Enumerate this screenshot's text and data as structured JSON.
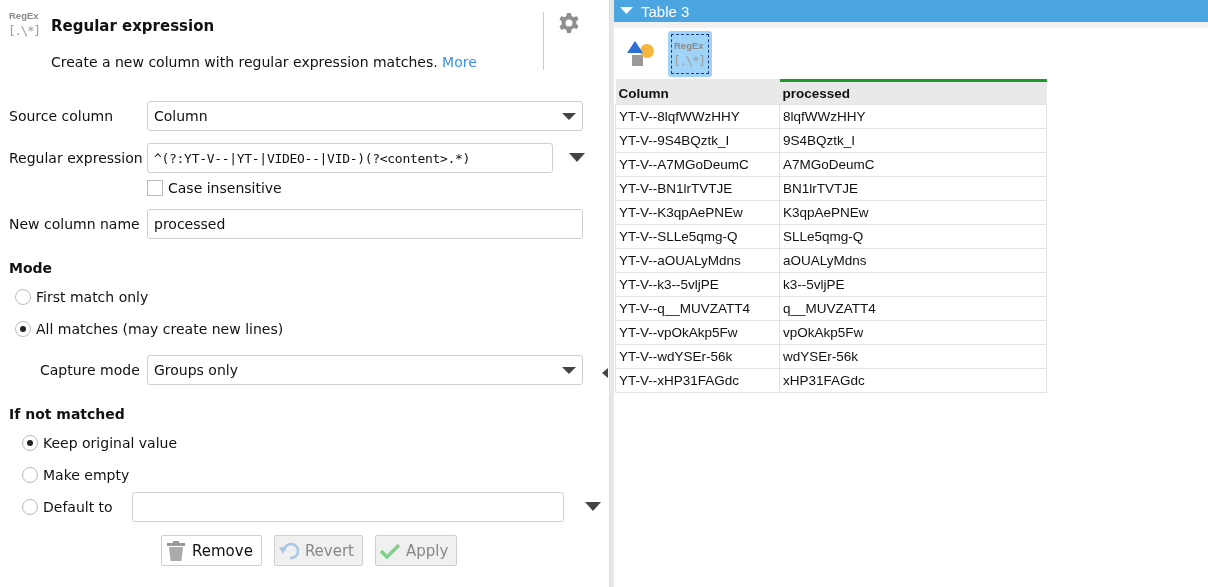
{
  "node": {
    "icon_label": "RegEx",
    "icon_symbol": "[.\\*]",
    "title": "Regular expression",
    "description": "Create a new column with regular expression matches.",
    "more_link": "More"
  },
  "source_column": {
    "label": "Source column",
    "value": "Column"
  },
  "regular_expression": {
    "label": "Regular expression",
    "value": "^(?:YT-V--|YT-|VIDEO--|VID-)(?<content>.*)"
  },
  "case_insensitive": {
    "label": "Case insensitive",
    "checked": false
  },
  "new_column_name": {
    "label": "New column name",
    "value": "processed"
  },
  "mode": {
    "title": "Mode",
    "options": [
      {
        "label": "First match only",
        "selected": false
      },
      {
        "label": "All matches (may create new lines)",
        "selected": true
      }
    ],
    "capture_mode": {
      "label": "Capture mode",
      "value": "Groups only"
    }
  },
  "if_not_matched": {
    "title": "If not matched",
    "options": [
      {
        "label": "Keep original value",
        "selected": true
      },
      {
        "label": "Make empty",
        "selected": false
      },
      {
        "label": "Default to",
        "selected": false
      }
    ]
  },
  "buttons": [
    {
      "kind": "remove",
      "label": "Remove",
      "disabled": false
    },
    {
      "kind": "revert",
      "label": "Revert",
      "disabled": true
    },
    {
      "kind": "apply",
      "label": "Apply",
      "disabled": true
    }
  ],
  "output": {
    "title": "Table 3",
    "tools": [
      {
        "kind": "shapes",
        "selected": false
      },
      {
        "kind": "regex",
        "selected": true,
        "icon_label": "RegEx",
        "icon_symbol": "[.\\*]"
      }
    ],
    "table": {
      "columns": [
        {
          "label": "Column",
          "highlighted": false
        },
        {
          "label": "processed",
          "highlighted": true
        }
      ],
      "rows": [
        [
          "YT-V--8lqfWWzHHY",
          "8lqfWWzHHY"
        ],
        [
          "YT-V--9S4BQztk_I",
          "9S4BQztk_I"
        ],
        [
          "YT-V--A7MGoDeumC",
          "A7MGoDeumC"
        ],
        [
          "YT-V--BN1lrTVTJE",
          "BN1lrTVTJE"
        ],
        [
          "YT-V--K3qpAePNEw",
          "K3qpAePNEw"
        ],
        [
          "YT-V--SLLe5qmg-Q",
          "SLLe5qmg-Q"
        ],
        [
          "YT-V--aOUALyMdns",
          "aOUALyMdns"
        ],
        [
          "YT-V--k3--5vljPE",
          "k3--5vljPE"
        ],
        [
          "YT-V--q__MUVZATT4",
          "q__MUVZATT4"
        ],
        [
          "YT-V--vpOkAkp5Fw",
          "vpOkAkp5Fw"
        ],
        [
          "YT-V--wdYSEr-56k",
          "wdYSEr-56k"
        ],
        [
          "YT-V--xHP31FAGdc",
          "xHP31FAGdc"
        ]
      ]
    }
  }
}
